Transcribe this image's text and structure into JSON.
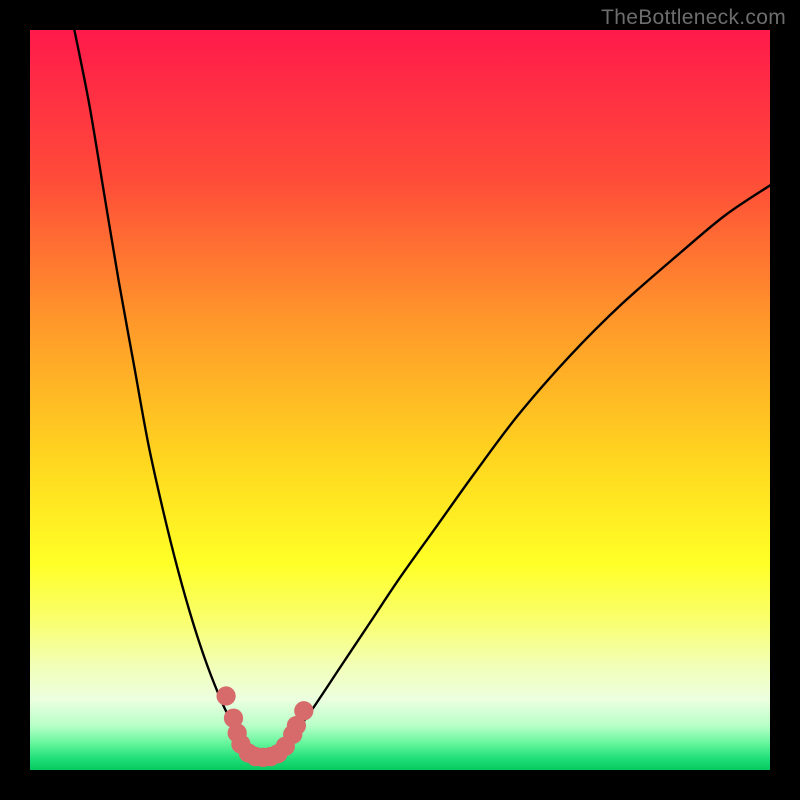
{
  "watermark": "TheBottleneck.com",
  "chart_data": {
    "type": "line",
    "title": "",
    "xlabel": "",
    "ylabel": "",
    "xlim": [
      0,
      100
    ],
    "ylim": [
      0,
      100
    ],
    "grid": false,
    "legend": false,
    "gradient_stops": [
      {
        "offset": 0.0,
        "color": "#ff1a4b"
      },
      {
        "offset": 0.2,
        "color": "#ff4b39"
      },
      {
        "offset": 0.4,
        "color": "#ff9a2a"
      },
      {
        "offset": 0.58,
        "color": "#ffd61f"
      },
      {
        "offset": 0.72,
        "color": "#ffff26"
      },
      {
        "offset": 0.8,
        "color": "#f9ff70"
      },
      {
        "offset": 0.86,
        "color": "#f2ffb8"
      },
      {
        "offset": 0.905,
        "color": "#ecffe0"
      },
      {
        "offset": 0.94,
        "color": "#b8ffc8"
      },
      {
        "offset": 0.965,
        "color": "#62f59a"
      },
      {
        "offset": 0.985,
        "color": "#1ede78"
      },
      {
        "offset": 1.0,
        "color": "#06c95f"
      }
    ],
    "series": [
      {
        "name": "left-curve",
        "x": [
          6,
          8,
          10,
          12,
          14,
          16,
          18,
          20,
          22,
          24,
          26,
          27,
          28,
          29,
          30
        ],
        "y": [
          100,
          90,
          78,
          66,
          55,
          44,
          35,
          27,
          20,
          14,
          9,
          7,
          5,
          3,
          2
        ]
      },
      {
        "name": "right-curve",
        "x": [
          33,
          35,
          38,
          42,
          46,
          50,
          55,
          60,
          66,
          73,
          80,
          88,
          94,
          100
        ],
        "y": [
          2,
          4,
          8,
          14,
          20,
          26,
          33,
          40,
          48,
          56,
          63,
          70,
          75,
          79
        ]
      }
    ],
    "markers": {
      "name": "highlight-dots",
      "color": "#d76a6a",
      "radius_pct": 1.3,
      "points": [
        {
          "x": 26.5,
          "y": 10
        },
        {
          "x": 27.5,
          "y": 7
        },
        {
          "x": 28.0,
          "y": 5
        },
        {
          "x": 28.5,
          "y": 3.5
        },
        {
          "x": 29.5,
          "y": 2.3
        },
        {
          "x": 30.5,
          "y": 1.8
        },
        {
          "x": 31.5,
          "y": 1.7
        },
        {
          "x": 32.5,
          "y": 1.8
        },
        {
          "x": 33.5,
          "y": 2.2
        },
        {
          "x": 34.5,
          "y": 3.2
        },
        {
          "x": 35.5,
          "y": 4.8
        },
        {
          "x": 36.0,
          "y": 6.0
        },
        {
          "x": 37.0,
          "y": 8.0
        }
      ]
    }
  }
}
